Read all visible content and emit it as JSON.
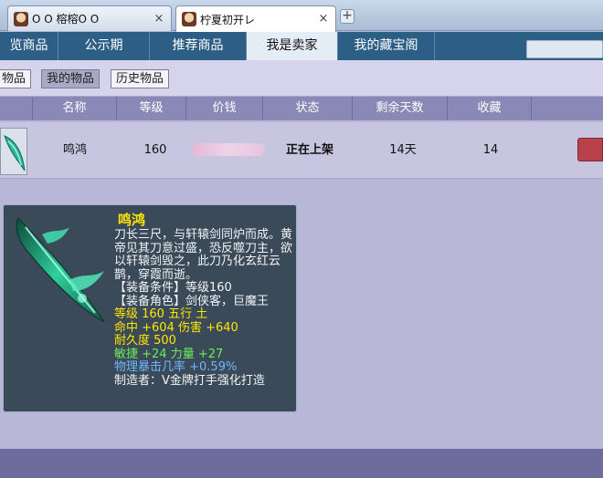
{
  "browser": {
    "tabs": [
      {
        "title": "O O 榕榕O O",
        "active": false
      },
      {
        "title": "柠夏初开レ",
        "active": true
      }
    ],
    "new_tab": "+",
    "close": "×"
  },
  "nav": {
    "items": [
      "览商品",
      "公示期",
      "推荐商品",
      "我是卖家",
      "我的藏宝阁"
    ],
    "active": "我是卖家"
  },
  "subtabs": {
    "items": [
      "物品",
      "我的物品",
      "历史物品"
    ],
    "active": "我的物品"
  },
  "table": {
    "headers": [
      "名称",
      "等级",
      "价钱",
      "状态",
      "剩余天数",
      "收藏"
    ],
    "rows": [
      {
        "name": "鸣鸿",
        "level": "160",
        "price": "",
        "status": "正在上架",
        "days_left": "14天",
        "favorites": "14"
      }
    ]
  },
  "tooltip": {
    "name": "鸣鸿",
    "description": "刀长三尺，与轩辕剑同炉而成。黄帝见其刀意过盛，恐反噬刀主，欲以轩辕剑毁之，此刀乃化玄红云鹊，穿霞而逝。",
    "req_level": "【装备条件】等级160",
    "req_role": "【装备角色】剑侠客，巨魔王",
    "stats_level": "等级 160  五行 土",
    "stats_hit": "命中 +604 伤害 +640",
    "durability": "耐久度 500",
    "bonus_agility": "敏捷 +24 力量 +27",
    "bonus_crit": "物理暴击几率 +0.59%",
    "maker": "制造者：V金牌打手强化打造"
  },
  "colors": {
    "nav_bg": "#2d5f86",
    "page_bg": "#b9b7d8",
    "header_bg": "#8a88b7",
    "tooltip_bg": "#3b4a58",
    "tooltip_yellow": "#ffe600",
    "tooltip_green": "#6bec5a",
    "tooltip_blue": "#6fb7ff",
    "buy_button": "#b8414a"
  }
}
